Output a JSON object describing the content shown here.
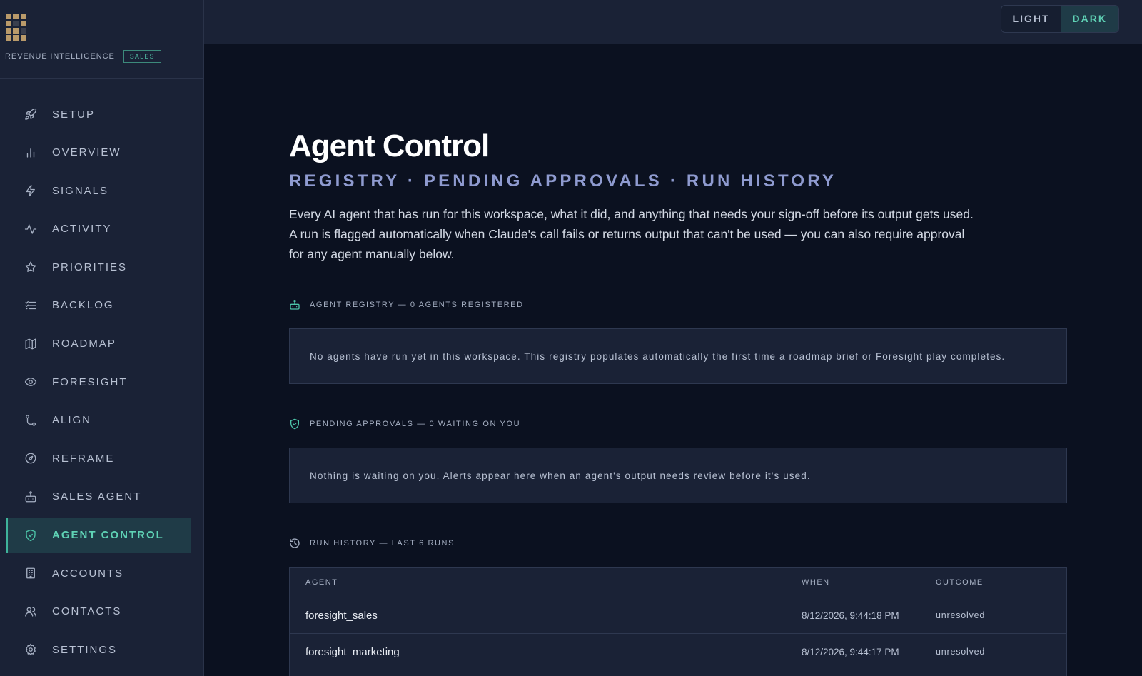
{
  "brand": {
    "name": "REVENUE INTELLIGENCE",
    "badge": "SALES"
  },
  "theme": {
    "light_label": "LIGHT",
    "dark_label": "DARK",
    "selected": "DARK"
  },
  "sidebar": {
    "items": [
      {
        "label": "SETUP",
        "icon": "rocket-icon"
      },
      {
        "label": "OVERVIEW",
        "icon": "bar-chart-icon"
      },
      {
        "label": "SIGNALS",
        "icon": "lightning-icon"
      },
      {
        "label": "ACTIVITY",
        "icon": "pulse-icon"
      },
      {
        "label": "PRIORITIES",
        "icon": "star-icon"
      },
      {
        "label": "BACKLOG",
        "icon": "checklist-icon"
      },
      {
        "label": "ROADMAP",
        "icon": "map-icon"
      },
      {
        "label": "FORESIGHT",
        "icon": "eye-icon"
      },
      {
        "label": "ALIGN",
        "icon": "route-icon"
      },
      {
        "label": "REFRAME",
        "icon": "compass-icon"
      },
      {
        "label": "SALES AGENT",
        "icon": "robot-icon"
      },
      {
        "label": "AGENT CONTROL",
        "icon": "shield-check-icon",
        "active": true
      },
      {
        "label": "ACCOUNTS",
        "icon": "building-icon"
      },
      {
        "label": "CONTACTS",
        "icon": "users-icon"
      },
      {
        "label": "SETTINGS",
        "icon": "gear-icon"
      }
    ]
  },
  "page": {
    "title": "Agent Control",
    "subtitle": "REGISTRY · PENDING APPROVALS · RUN HISTORY",
    "description": "Every AI agent that has run for this workspace, what it did, and anything that needs your sign-off before its output gets used. A run is flagged automatically when Claude's call fails or returns output that can't be used — you can also require approval for any agent manually below."
  },
  "registry": {
    "heading": "AGENT REGISTRY — 0 AGENTS REGISTERED",
    "empty_text": "No agents have run yet in this workspace. This registry populates automatically the first time a roadmap brief or Foresight play completes."
  },
  "approvals": {
    "heading": "PENDING APPROVALS — 0 WAITING ON YOU",
    "empty_text": "Nothing is waiting on you. Alerts appear here when an agent's output needs review before it's used."
  },
  "run_history": {
    "heading": "RUN HISTORY — LAST 6 RUNS",
    "columns": [
      "AGENT",
      "WHEN",
      "OUTCOME"
    ],
    "rows": [
      {
        "agent": "foresight_sales",
        "when": "8/12/2026, 9:44:18 PM",
        "outcome": "unresolved"
      },
      {
        "agent": "foresight_marketing",
        "when": "8/12/2026, 9:44:17 PM",
        "outcome": "unresolved"
      }
    ]
  },
  "colors": {
    "accent": "#4cc4a8",
    "background": "#0b1120",
    "panel": "#1a2236",
    "subtitle": "#8f9bd0"
  }
}
